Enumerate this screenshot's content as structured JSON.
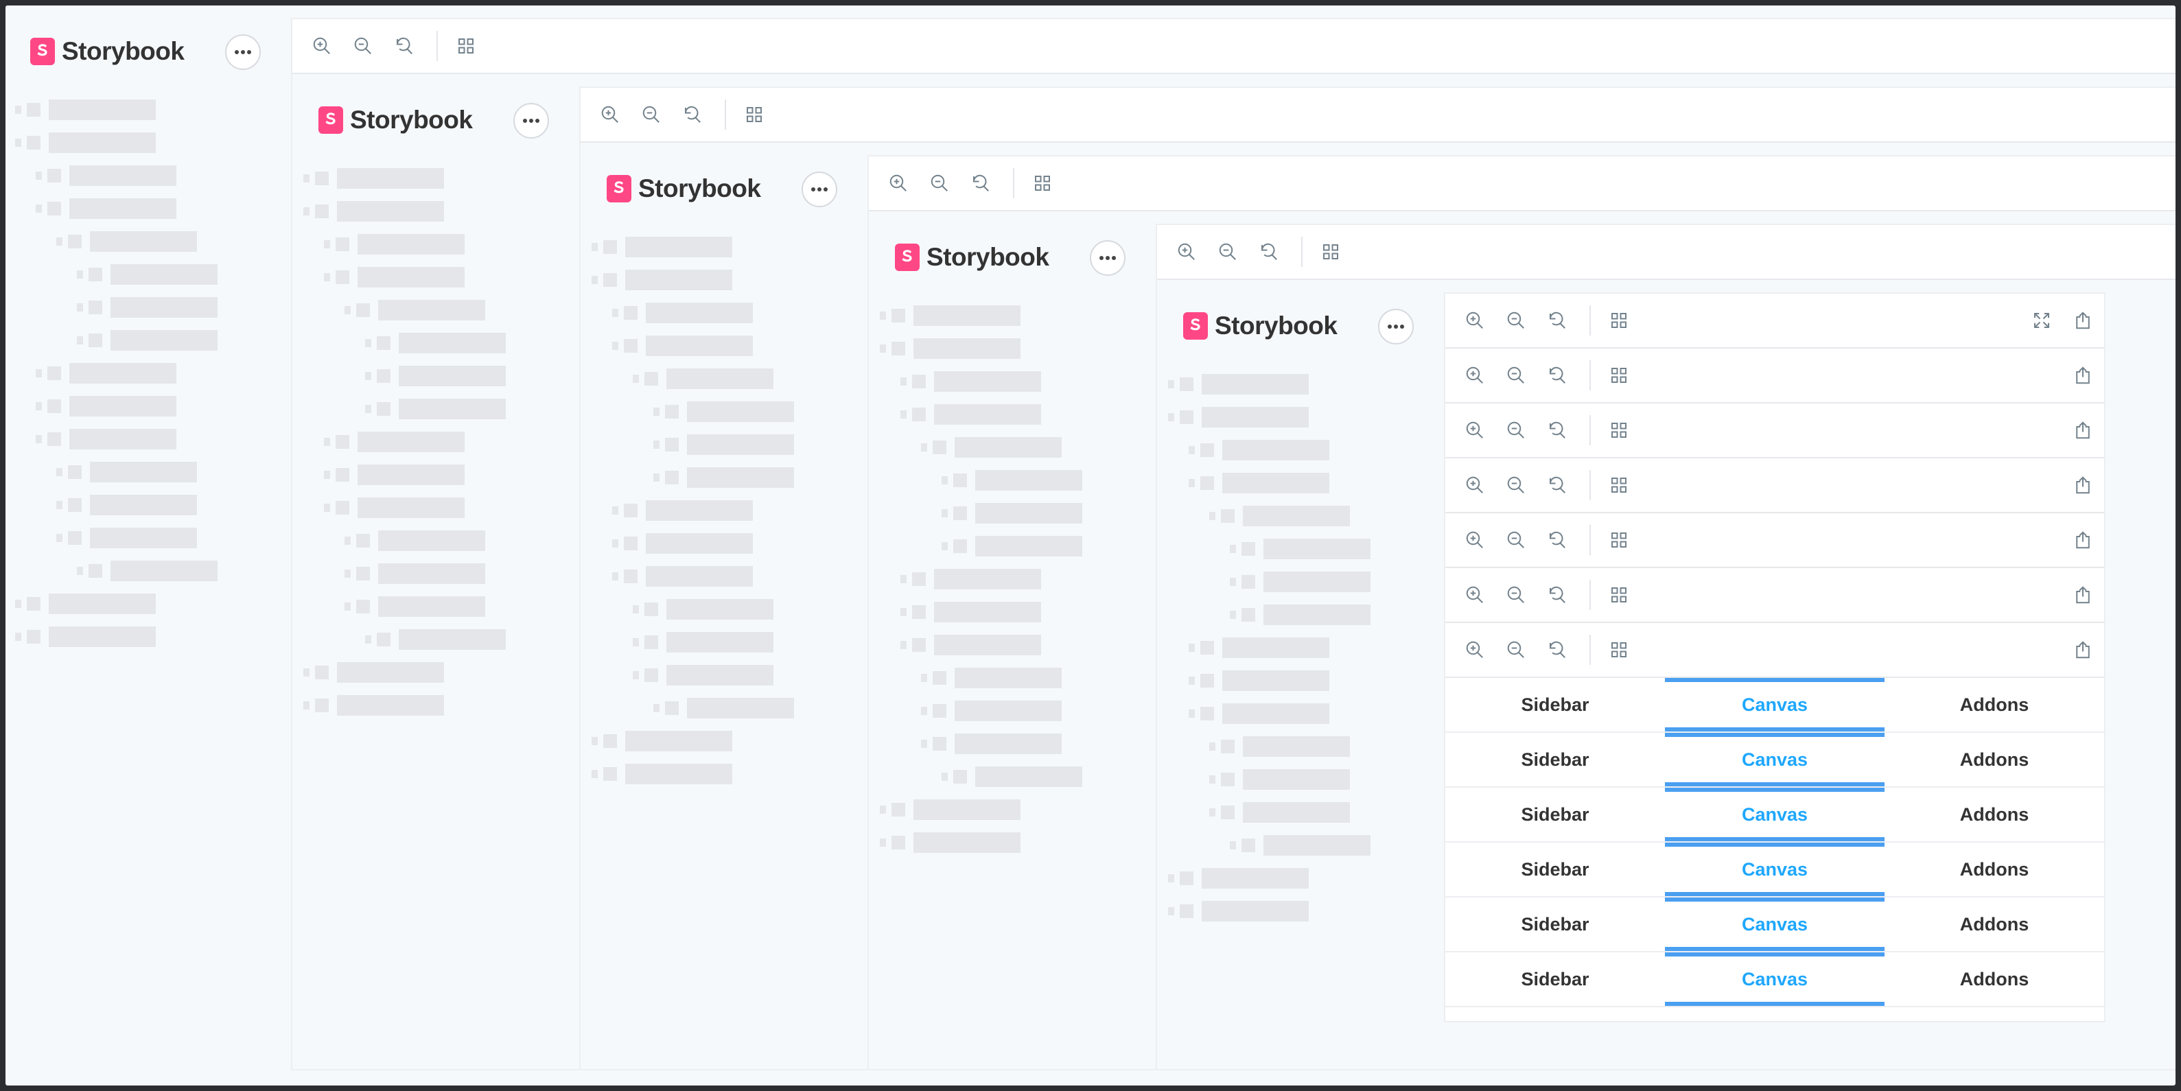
{
  "app": {
    "brand": "Storybook"
  },
  "icons": {
    "zoom_in": "zoom-in-icon",
    "zoom_out": "zoom-out-icon",
    "reset": "reset-zoom-icon",
    "grid": "grid-icon",
    "fullscreen": "fullscreen-icon",
    "share": "share-icon",
    "menu": "ellipsis-icon"
  },
  "tabs": [
    {
      "label": "Sidebar"
    },
    {
      "label": "Canvas"
    },
    {
      "label": "Addons"
    }
  ],
  "colors": {
    "brand_pink": "#ff4785",
    "accent_blue": "#1ea7fd",
    "tab_underline": "#4a9ff1",
    "skeleton": "#e4e6ea",
    "background": "#f6f9fc"
  }
}
